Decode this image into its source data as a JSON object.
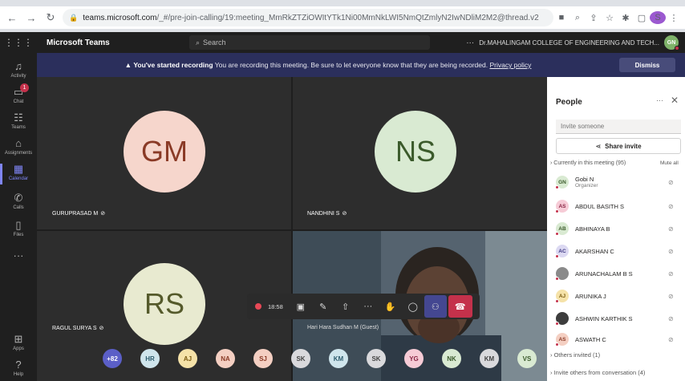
{
  "browser": {
    "url_host": "teams.microsoft.com",
    "url_path": "/_#/pre-join-calling/19:meeting_MmRkZTZiOWItYTk1Ni00MmNkLWI5NmQtZmlyN2IwNDliM2M2@thread.v2",
    "profile_initial": "S"
  },
  "header": {
    "app_title": "Microsoft Teams",
    "search_placeholder": "Search",
    "org_name": "Dr.MAHALINGAM COLLEGE OF ENGINEERING AND TECH...",
    "user_initials": "GN"
  },
  "rail": {
    "items": [
      {
        "label": "Activity",
        "icon": "bell-icon"
      },
      {
        "label": "Chat",
        "icon": "chat-icon",
        "badge": "1"
      },
      {
        "label": "Teams",
        "icon": "teams-icon"
      },
      {
        "label": "Assignments",
        "icon": "assignments-icon"
      },
      {
        "label": "Calendar",
        "icon": "calendar-icon"
      },
      {
        "label": "Calls",
        "icon": "phone-icon"
      },
      {
        "label": "Files",
        "icon": "file-icon"
      },
      {
        "label": "Apps",
        "icon": "apps-icon"
      },
      {
        "label": "Help",
        "icon": "help-icon"
      }
    ]
  },
  "banner": {
    "bold": "You've started recording",
    "text": " You are recording this meeting. Be sure to let everyone know that they are being recorded. ",
    "link": "Privacy policy",
    "dismiss": "Dismiss"
  },
  "tiles": [
    {
      "initials": "GM",
      "name": "GURUPRASAD M",
      "bg": "#f6d6cc",
      "fg": "#8a3a26"
    },
    {
      "initials": "NS",
      "name": "NANDHINI S",
      "bg": "#d9ead2",
      "fg": "#3b5a2b"
    },
    {
      "initials": "RS",
      "name": "RAGUL SURYA S",
      "bg": "#e8ead0",
      "fg": "#555a2b"
    },
    {
      "name": "Hari Hara Sudhan M (Guest)"
    }
  ],
  "controls": {
    "timer": "18:58"
  },
  "roster_strip": [
    {
      "initials": "+82",
      "bg": "#5b5fc7",
      "fg": "#fff"
    },
    {
      "initials": "HR",
      "bg": "#cfe5ec",
      "fg": "#2e5d6e"
    },
    {
      "initials": "AJ",
      "bg": "#f5e2a8",
      "fg": "#7a5a10"
    },
    {
      "initials": "NA",
      "bg": "#f4cfc2",
      "fg": "#8a3a26"
    },
    {
      "initials": "SJ",
      "bg": "#f4cfc2",
      "fg": "#8a3a26"
    },
    {
      "initials": "SK",
      "bg": "#d9d9dc",
      "fg": "#444"
    },
    {
      "initials": "KM",
      "bg": "#cfe5ec",
      "fg": "#2e5d6e"
    },
    {
      "initials": "SK",
      "bg": "#d9d9dc",
      "fg": "#444"
    },
    {
      "initials": "YG",
      "bg": "#f6cbd6",
      "fg": "#8a2645"
    },
    {
      "initials": "NK",
      "bg": "#d9ead2",
      "fg": "#3b5a2b"
    },
    {
      "initials": "KM",
      "bg": "#d9d9dc",
      "fg": "#444"
    },
    {
      "initials": "VS",
      "bg": "#d9ead2",
      "fg": "#3b5a2b"
    }
  ],
  "people": {
    "title": "People",
    "invite_placeholder": "Invite someone",
    "share_invite": "Share invite",
    "in_meeting": "Currently in this meeting (95)",
    "mute_all": "Mute all",
    "list": [
      {
        "initials": "GN",
        "name": "Gobi N",
        "role": "Organizer",
        "bg": "#d9ead2",
        "fg": "#3b5a2b"
      },
      {
        "initials": "AS",
        "name": "ABDUL BASITH S",
        "bg": "#f6cbd6",
        "fg": "#8a2645"
      },
      {
        "initials": "AB",
        "name": "ABHINAYA B",
        "bg": "#d9ead2",
        "fg": "#3b5a2b"
      },
      {
        "initials": "AC",
        "name": "AKARSHAN C",
        "bg": "#dcd9f2",
        "fg": "#3b3580"
      },
      {
        "initials": "",
        "name": "ARUNACHALAM B S",
        "bg": "#8a8a8a",
        "fg": "#fff"
      },
      {
        "initials": "AJ",
        "name": "ARUNIKA J",
        "bg": "#f5e2a8",
        "fg": "#7a5a10"
      },
      {
        "initials": "",
        "name": "ASHWIN KARTHIK S",
        "bg": "#3d3d3d",
        "fg": "#fff"
      },
      {
        "initials": "AS",
        "name": "ASWATH C",
        "bg": "#f4cfc2",
        "fg": "#8a3a26"
      }
    ],
    "others_invited": "Others invited (1)",
    "invite_others": "Invite others from conversation (4)"
  }
}
